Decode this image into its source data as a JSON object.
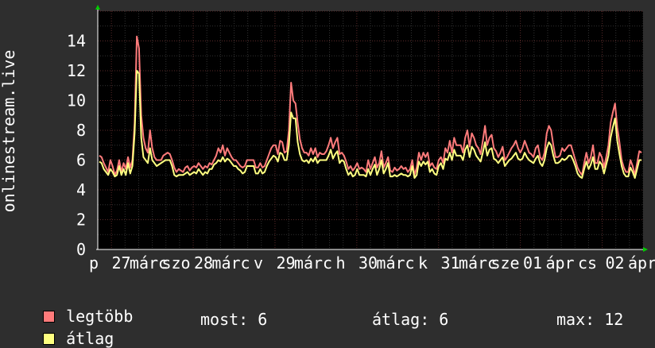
{
  "chart_data": {
    "type": "line",
    "ylabel": "onlinestream.live",
    "ylim": [
      0,
      16
    ],
    "yticks": [
      0,
      2,
      4,
      6,
      8,
      10,
      12,
      14
    ],
    "xtick_labels": [
      "p",
      "27",
      "márc",
      "szo",
      "28",
      "márc",
      "v",
      "29",
      "márc",
      "h",
      "30",
      "márc",
      "k",
      "31",
      "márc",
      "sze",
      "01",
      "ápr",
      "cs",
      "02",
      "ápr"
    ],
    "series": [
      {
        "name": "legtöbb",
        "color": "#ff7b7b",
        "values": [
          6.3,
          6.2,
          5.8,
          5.5,
          5.2,
          6.0,
          5.6,
          5.0,
          5.3,
          6.0,
          5.2,
          5.8,
          5.4,
          6.2,
          5.5,
          6.0,
          8.5,
          14.3,
          13.5,
          9.0,
          7.5,
          6.8,
          6.5,
          8.0,
          6.8,
          6.2,
          6.0,
          6.0,
          6.0,
          6.3,
          6.4,
          6.5,
          6.4,
          6.0,
          5.5,
          5.2,
          5.4,
          5.3,
          5.2,
          5.5,
          5.6,
          5.3,
          5.5,
          5.6,
          5.5,
          5.8,
          5.6,
          5.4,
          5.6,
          5.5,
          5.8,
          5.7,
          6.0,
          6.3,
          6.8,
          6.5,
          7.0,
          6.3,
          6.8,
          6.5,
          6.2,
          6.0,
          6.0,
          5.8,
          5.6,
          5.5,
          5.6,
          6.0,
          6.0,
          6.0,
          6.0,
          5.5,
          5.5,
          5.8,
          5.5,
          5.6,
          6.0,
          6.4,
          6.8,
          7.0,
          7.0,
          6.4,
          7.3,
          7.2,
          6.5,
          6.6,
          8.0,
          11.2,
          10.0,
          9.8,
          8.5,
          7.4,
          6.8,
          6.5,
          6.5,
          6.3,
          6.8,
          6.4,
          6.8,
          6.2,
          6.5,
          6.4,
          6.4,
          6.6,
          7.0,
          7.5,
          6.8,
          7.2,
          7.5,
          6.4,
          6.5,
          6.3,
          5.9,
          5.4,
          5.6,
          5.3,
          5.5,
          5.8,
          5.4,
          5.5,
          5.4,
          5.2,
          6.0,
          5.4,
          5.8,
          6.2,
          5.5,
          5.8,
          6.6,
          5.5,
          5.8,
          6.2,
          5.3,
          5.2,
          5.5,
          5.3,
          5.4,
          5.6,
          5.4,
          5.5,
          5.2,
          5.4,
          6.0,
          5.0,
          5.5,
          6.5,
          6.0,
          6.5,
          6.2,
          6.5,
          5.6,
          5.8,
          5.5,
          5.4,
          6.0,
          6.2,
          5.8,
          6.8,
          6.5,
          7.3,
          6.5,
          7.5,
          7.0,
          7.0,
          7.0,
          6.5,
          7.5,
          8.0,
          6.9,
          7.8,
          7.5,
          7.0,
          6.8,
          6.4,
          7.3,
          8.3,
          7.0,
          7.5,
          7.7,
          6.8,
          6.6,
          6.2,
          6.5,
          6.9,
          6.0,
          6.2,
          6.5,
          6.8,
          7.0,
          7.3,
          6.8,
          6.5,
          6.8,
          7.3,
          6.9,
          6.5,
          6.4,
          6.2,
          6.8,
          7.0,
          6.2,
          6.0,
          6.5,
          7.8,
          8.3,
          8.0,
          7.0,
          6.2,
          6.2,
          6.3,
          6.8,
          6.6,
          6.8,
          7.0,
          7.0,
          6.5,
          6.0,
          5.5,
          5.2,
          5.0,
          5.8,
          6.5,
          5.8,
          6.2,
          7.0,
          5.8,
          5.8,
          6.5,
          6.2,
          5.5,
          6.2,
          7.0,
          8.5,
          9.2,
          9.8,
          8.2,
          7.2,
          6.0,
          5.5,
          5.2,
          5.2,
          6.0,
          5.6,
          5.0,
          5.8,
          6.6,
          6.5
        ]
      },
      {
        "name": "átlag",
        "color": "#ffff80",
        "values": [
          5.9,
          5.8,
          5.4,
          5.2,
          5.0,
          5.4,
          5.2,
          4.9,
          5.0,
          5.6,
          5.0,
          5.4,
          5.0,
          5.8,
          5.1,
          5.6,
          7.8,
          12.0,
          11.8,
          7.5,
          6.2,
          6.0,
          5.8,
          6.8,
          6.0,
          5.8,
          5.6,
          5.7,
          5.8,
          5.9,
          6.0,
          6.0,
          6.0,
          5.6,
          5.0,
          4.9,
          5.0,
          5.0,
          5.0,
          5.1,
          5.2,
          5.0,
          5.1,
          5.2,
          5.1,
          5.4,
          5.2,
          5.0,
          5.2,
          5.1,
          5.4,
          5.4,
          5.7,
          5.8,
          6.0,
          5.9,
          6.2,
          5.9,
          6.1,
          6.0,
          5.8,
          5.6,
          5.6,
          5.4,
          5.3,
          5.1,
          5.2,
          5.6,
          5.6,
          5.6,
          5.6,
          5.1,
          5.1,
          5.4,
          5.1,
          5.2,
          5.6,
          5.9,
          6.1,
          6.3,
          6.2,
          5.9,
          6.5,
          6.4,
          6.0,
          6.0,
          7.0,
          9.2,
          8.8,
          8.8,
          7.2,
          6.4,
          6.0,
          5.9,
          6.0,
          5.8,
          6.1,
          5.9,
          6.2,
          5.8,
          6.0,
          6.0,
          6.0,
          6.0,
          6.3,
          6.7,
          6.1,
          6.4,
          6.6,
          5.8,
          6.0,
          5.9,
          5.4,
          5.0,
          5.2,
          4.9,
          5.0,
          5.4,
          5.0,
          5.0,
          5.0,
          4.9,
          5.4,
          5.0,
          5.4,
          5.7,
          5.0,
          5.4,
          6.0,
          5.1,
          5.4,
          5.8,
          4.9,
          4.9,
          5.0,
          4.9,
          5.0,
          5.1,
          5.0,
          5.0,
          4.9,
          5.0,
          5.6,
          4.8,
          5.0,
          5.9,
          5.6,
          5.9,
          5.7,
          5.9,
          5.2,
          5.4,
          5.1,
          5.0,
          5.6,
          5.8,
          5.4,
          6.1,
          6.0,
          6.5,
          6.0,
          6.7,
          6.3,
          6.3,
          6.3,
          6.0,
          6.7,
          7.0,
          6.2,
          6.9,
          6.7,
          6.3,
          6.1,
          5.9,
          6.5,
          7.2,
          6.3,
          6.7,
          6.8,
          6.1,
          6.0,
          5.8,
          6.0,
          6.2,
          5.6,
          5.8,
          6.0,
          6.1,
          6.3,
          6.5,
          6.1,
          6.0,
          6.1,
          6.5,
          6.2,
          6.0,
          5.9,
          5.8,
          6.1,
          6.3,
          5.8,
          5.6,
          6.0,
          6.8,
          7.2,
          7.0,
          6.3,
          5.8,
          5.8,
          5.9,
          6.1,
          6.0,
          6.1,
          6.3,
          6.3,
          6.0,
          5.6,
          5.1,
          4.9,
          4.8,
          5.4,
          5.9,
          5.4,
          5.7,
          6.2,
          5.4,
          5.4,
          5.9,
          5.7,
          5.1,
          5.7,
          6.3,
          7.5,
          8.2,
          8.8,
          7.3,
          6.4,
          5.6,
          5.1,
          4.9,
          4.9,
          5.5,
          5.2,
          4.8,
          5.4,
          6.0,
          6.0
        ]
      }
    ],
    "grid": true
  },
  "legend": {
    "items": [
      {
        "label": "legtöbb",
        "color": "#ff7b7b"
      },
      {
        "label": "átlag",
        "color": "#ffff80"
      }
    ]
  },
  "stats": {
    "now": "most: 6",
    "avg": "átlag: 6",
    "max": "max: 12"
  }
}
